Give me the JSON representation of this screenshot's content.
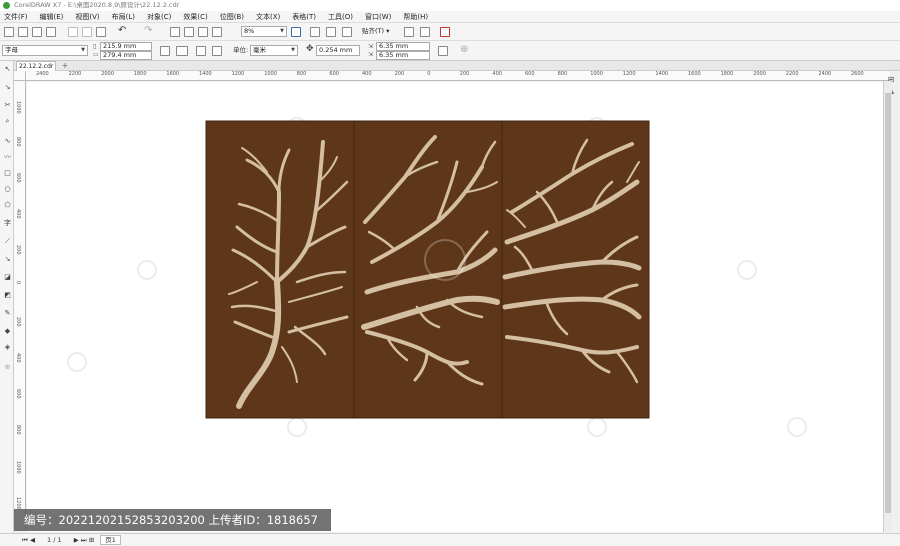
{
  "window": {
    "title": "CorelDRAW X7 - E:\\桌面2020.8.9\\原设计\\22.12.2.cdr"
  },
  "menu": [
    "文件(F)",
    "编辑(E)",
    "视图(V)",
    "布局(L)",
    "对象(C)",
    "效果(C)",
    "位图(B)",
    "文本(X)",
    "表格(T)",
    "工具(O)",
    "窗口(W)",
    "帮助(H)"
  ],
  "toolbar": {
    "zoom": "8%",
    "snap_label": "贴齐(T)"
  },
  "property_bar": {
    "preset": "字母",
    "width": "215.9 mm",
    "height": "279.4 mm",
    "unit_label": "单位:",
    "unit": "毫米",
    "nudge": "0.254 mm",
    "dup_x": "6.35 mm",
    "dup_y": "6.35 mm"
  },
  "document_tab": "22.12.2.cdr",
  "ruler": {
    "h_ticks": [
      "2400",
      "2200",
      "2000",
      "1800",
      "1600",
      "1400",
      "1200",
      "1000",
      "800",
      "600",
      "400",
      "200",
      "0",
      "200",
      "400",
      "600",
      "800",
      "1000",
      "1200",
      "1400",
      "1600",
      "1800",
      "2000",
      "2200",
      "2400",
      "2600"
    ],
    "v_ticks": [
      "1000",
      "800",
      "600",
      "400",
      "200",
      "0",
      "200",
      "400",
      "600",
      "800",
      "1000",
      "1200"
    ]
  },
  "status": {
    "page_count": "1 / 1",
    "page_tab": "页1"
  },
  "watermark": "编号：20221202152853203200 上传者ID：1818657",
  "colors": {
    "panel": "#5e361a",
    "branch": "#d4bfa3"
  }
}
